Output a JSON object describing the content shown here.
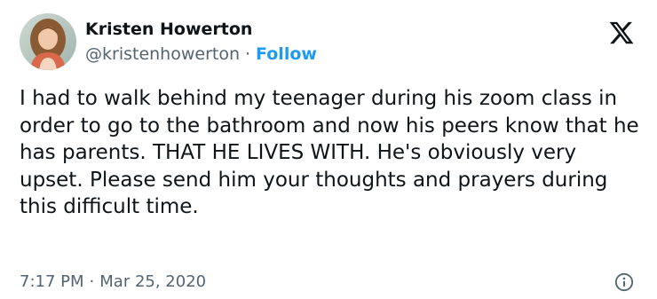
{
  "tweet": {
    "author": {
      "display_name": "Kristen Howerton",
      "handle": "@kristenhowerton"
    },
    "separator": "·",
    "follow_label": "Follow",
    "text": "I had to walk behind my teenager during his zoom class in order to go to the bathroom and now his peers know that he has parents. THAT HE LIVES WITH. He's obviously very upset. Please send him your thoughts and prayers during this difficult time.",
    "time": "7:17 PM",
    "date": "Mar 25, 2020",
    "brand_icon": "x-logo-icon",
    "info_icon": "info-icon"
  },
  "colors": {
    "text_primary": "#0f1419",
    "text_secondary": "#536471",
    "link": "#1d9bf0"
  }
}
